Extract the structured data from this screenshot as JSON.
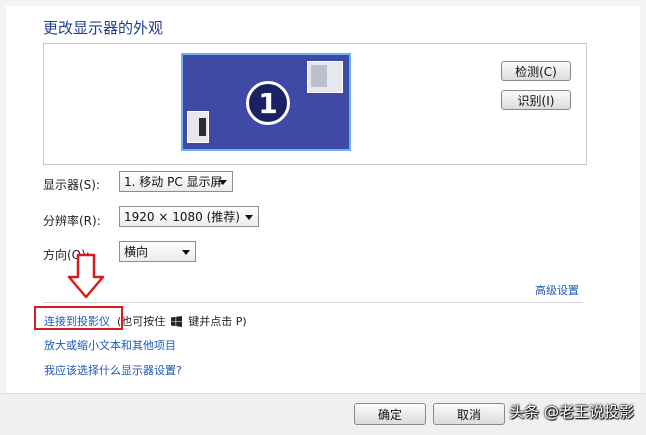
{
  "page": {
    "title": "更改显示器的外观"
  },
  "preview": {
    "monitor_number": "1",
    "detect_button": "检测(C)",
    "identify_button": "识别(I)"
  },
  "settings": {
    "display_label": "显示器(S):",
    "display_value": "1. 移动 PC 显示屏",
    "resolution_label": "分辨率(R):",
    "resolution_value": "1920 × 1080 (推荐)",
    "orientation_label": "方向(O):",
    "orientation_value": "横向"
  },
  "links": {
    "advanced": "高级设置",
    "connect_projector": "连接到投影仪",
    "connect_hint_prefix": "(也可按住",
    "connect_hint_suffix": "键并点击 P)",
    "text_size": "放大或缩小文本和其他项目",
    "which_settings": "我应该选择什么显示器设置?"
  },
  "footer": {
    "ok_button": "确定",
    "cancel_button": "取消"
  },
  "watermark": {
    "text": "头条 @老王说投影"
  },
  "colors": {
    "title": "#1e3d8f",
    "link": "#1e58b7",
    "monitor_fill": "#3e4aa6",
    "annotation_red": "#d51d1d"
  },
  "icons": {
    "windows_key": "windows-logo-icon",
    "annotation_arrow": "down-arrow-icon"
  }
}
